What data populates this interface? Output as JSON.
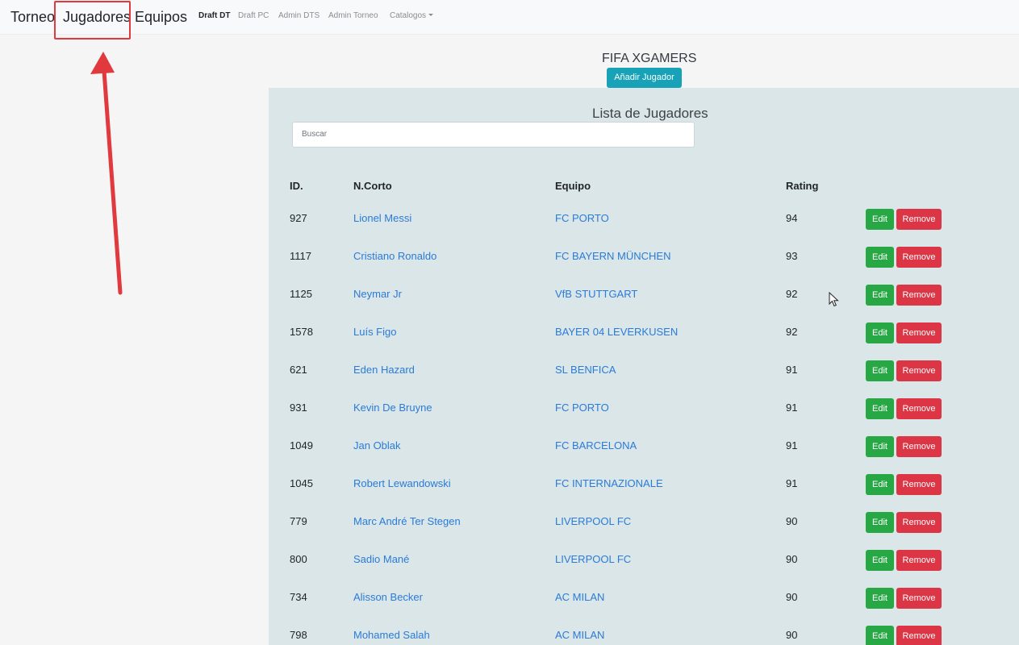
{
  "navbar": {
    "brand_torneo": "Torneo",
    "brand_jugadores": "Jugadores",
    "brand_equipos": "Equipos",
    "links": [
      "Draft DT",
      "Draft PC",
      "Admin DTS",
      "Admin Torneo",
      "Catalogos"
    ],
    "active_link": "Draft DT"
  },
  "header": {
    "title": "FIFA XGAMERS",
    "add_button": "Añadir Jugador"
  },
  "list": {
    "title": "Lista de Jugadores",
    "search_placeholder": "Buscar",
    "columns": [
      "ID.",
      "N.Corto",
      "Equipo",
      "Rating"
    ],
    "edit_label": "Edit",
    "remove_label": "Remove",
    "rows": [
      {
        "id": "927",
        "name": "Lionel Messi",
        "team": "FC PORTO",
        "rating": "94"
      },
      {
        "id": "1117",
        "name": "Cristiano Ronaldo",
        "team": "FC BAYERN MÜNCHEN",
        "rating": "93"
      },
      {
        "id": "1125",
        "name": "Neymar Jr",
        "team": "VfB STUTTGART",
        "rating": "92"
      },
      {
        "id": "1578",
        "name": "Luís Figo",
        "team": "BAYER 04 LEVERKUSEN",
        "rating": "92"
      },
      {
        "id": "621",
        "name": "Eden Hazard",
        "team": "SL BENFICA",
        "rating": "91"
      },
      {
        "id": "931",
        "name": "Kevin De Bruyne",
        "team": "FC PORTO",
        "rating": "91"
      },
      {
        "id": "1049",
        "name": "Jan Oblak",
        "team": "FC BARCELONA",
        "rating": "91"
      },
      {
        "id": "1045",
        "name": "Robert Lewandowski",
        "team": "FC INTERNAZIONALE",
        "rating": "91"
      },
      {
        "id": "779",
        "name": "Marc André Ter Stegen",
        "team": "LIVERPOOL FC",
        "rating": "90"
      },
      {
        "id": "800",
        "name": "Sadio Mané",
        "team": "LIVERPOOL FC",
        "rating": "90"
      },
      {
        "id": "734",
        "name": "Alisson Becker",
        "team": "AC MILAN",
        "rating": "90"
      },
      {
        "id": "798",
        "name": "Mohamed Salah",
        "team": "AC MILAN",
        "rating": "90"
      }
    ]
  },
  "colors": {
    "panel": "#dae6e7",
    "link": "#2b7bd8",
    "add_button": "#17a2b8",
    "edit_button": "#28a745",
    "remove_button": "#dc3545",
    "annotation": "#e0393e"
  },
  "icons": {
    "annotation_arrow": "up-arrow-icon",
    "mouse_cursor": "cursor-icon",
    "dropdown": "caret-down-icon"
  }
}
